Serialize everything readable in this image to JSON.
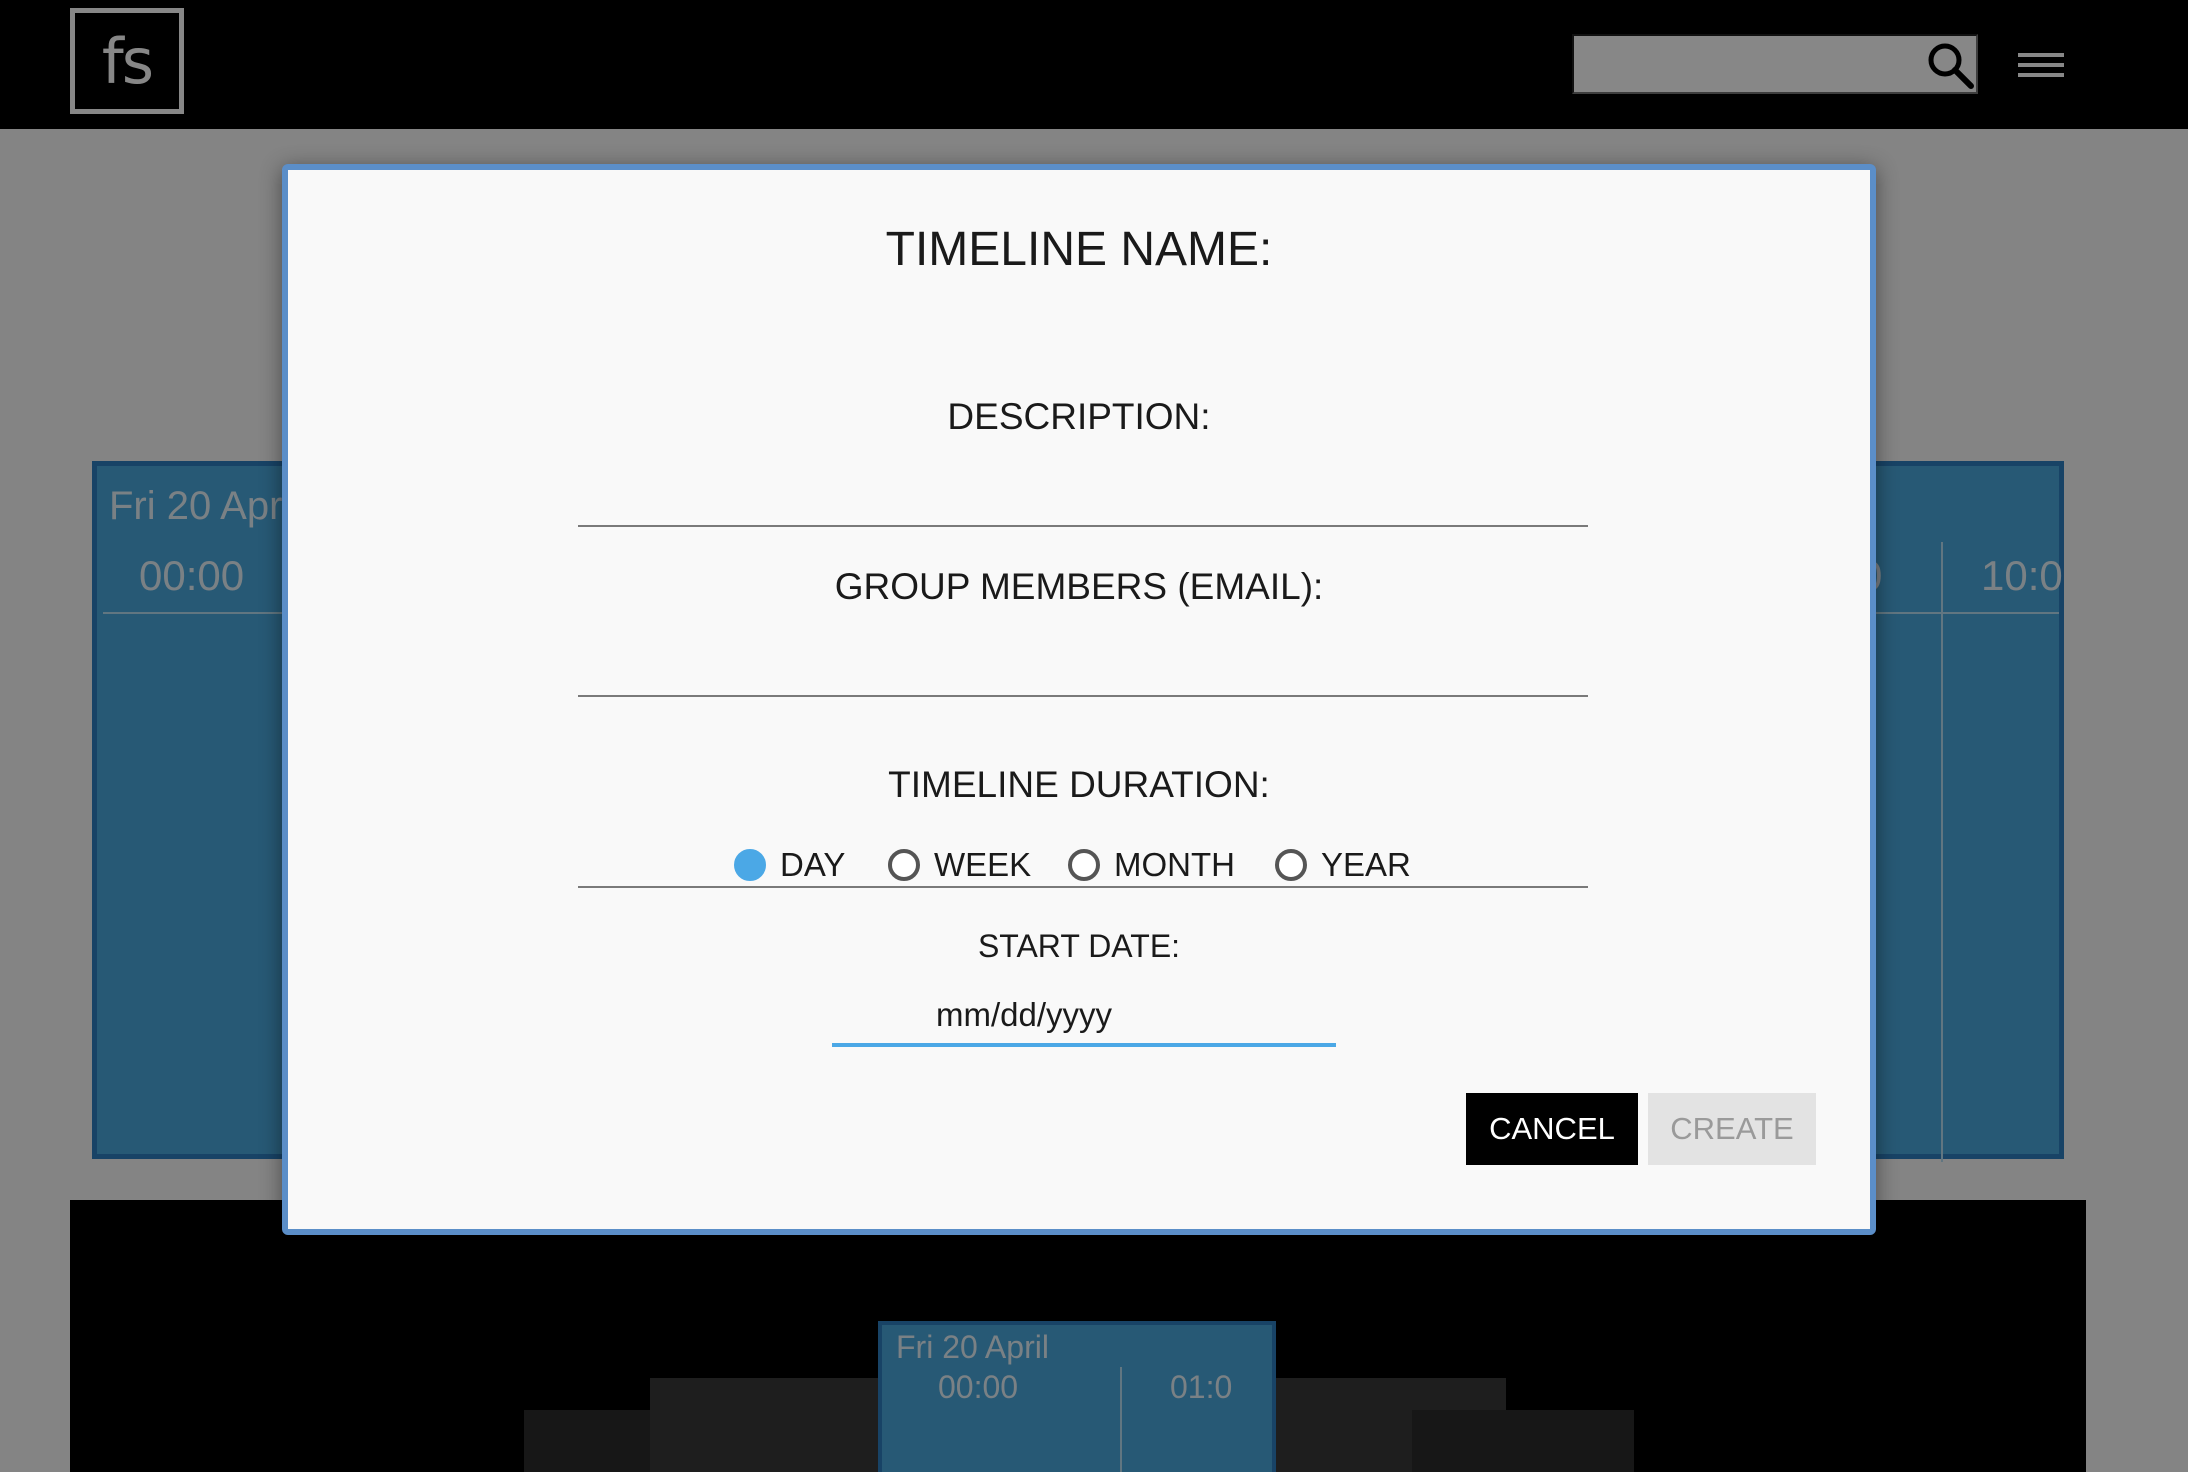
{
  "app": {
    "logo_text": "fs",
    "search": {
      "placeholder": ""
    }
  },
  "background": {
    "timeline": {
      "date": "Fri 20 April",
      "times": [
        "00:00",
        "10:0"
      ],
      "partial_time": "0"
    },
    "mini_timeline": {
      "date": "Fri 20 April",
      "times": [
        "00:00",
        "01:0"
      ]
    }
  },
  "modal": {
    "name_label": "TIMELINE NAME:",
    "description_label": "DESCRIPTION:",
    "members_label": "GROUP MEMBERS (EMAIL):",
    "duration_label": "TIMELINE DURATION:",
    "duration_options": [
      "DAY",
      "WEEK",
      "MONTH",
      "YEAR"
    ],
    "duration_selected": "DAY",
    "start_date_label": "START DATE:",
    "start_date_placeholder": "mm/dd/yyyy",
    "name_value": "",
    "description_value": "",
    "members_value": "",
    "cancel_label": "CANCEL",
    "create_label": "CREATE"
  },
  "colors": {
    "accent": "#4ba8e6",
    "timeline_fill": "#4aa8dd",
    "modal_border": "#5b8ec8"
  }
}
